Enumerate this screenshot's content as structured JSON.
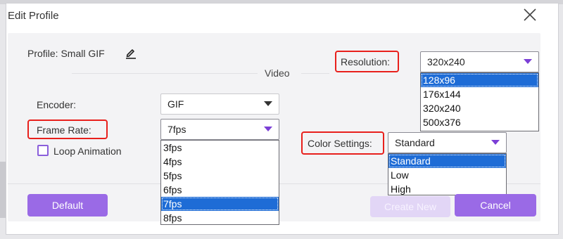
{
  "dialog": {
    "title": "Edit Profile",
    "close_icon": "close-icon"
  },
  "profile": {
    "label": "Profile:",
    "value": "Small GIF",
    "edit_icon": "pencil-icon"
  },
  "section_title": "Video",
  "encoder": {
    "label": "Encoder:",
    "value": "GIF"
  },
  "frame_rate": {
    "label": "Frame Rate:",
    "value": "7fps",
    "options": [
      "3fps",
      "4fps",
      "5fps",
      "6fps",
      "7fps",
      "8fps"
    ],
    "selected_index": 4
  },
  "loop_animation": {
    "label": "Loop Animation",
    "checked": false
  },
  "resolution": {
    "label": "Resolution:",
    "value": "320x240",
    "options": [
      "128x96",
      "176x144",
      "320x240",
      "500x376"
    ],
    "selected_index": 0
  },
  "color_settings": {
    "label": "Color Settings:",
    "value": "Standard",
    "options": [
      "Standard",
      "Low",
      "High"
    ],
    "selected_index": 0
  },
  "buttons": {
    "default": "Default",
    "create_new": "Create New",
    "cancel": "Cancel"
  },
  "colors": {
    "accent": "#9a6ae6",
    "highlight": "#e8201c",
    "selection": "#1e6cd6"
  }
}
